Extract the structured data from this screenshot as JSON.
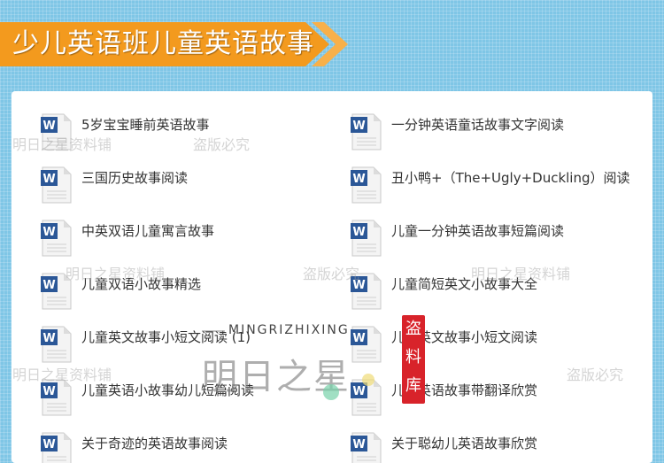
{
  "banner": {
    "title": "少儿英语班儿童英语故事"
  },
  "files_left": [
    {
      "name": "5岁宝宝睡前英语故事"
    },
    {
      "name": "三国历史故事阅读"
    },
    {
      "name": "中英双语儿童寓言故事"
    },
    {
      "name": "儿童双语小故事精选"
    },
    {
      "name": "儿童英文故事小短文阅读 (1)"
    },
    {
      "name": "儿童英语小故事幼儿短篇阅读"
    },
    {
      "name": "关于奇迹的英语故事阅读"
    }
  ],
  "files_right": [
    {
      "name": "一分钟英语童话故事文字阅读"
    },
    {
      "name": "丑小鸭+（The+Ugly+Duckling）阅读"
    },
    {
      "name": "儿童一分钟英语故事短篇阅读"
    },
    {
      "name": "儿童简短英文小故事大全"
    },
    {
      "name": "儿童英文故事小短文阅读"
    },
    {
      "name": "儿童英语故事带翻译欣赏"
    },
    {
      "name": "关于聪幼儿英语故事欣赏"
    }
  ],
  "icons": {
    "file": "word-document-icon"
  },
  "colors": {
    "banner": "#f39a1e",
    "background": "#7fc6e6",
    "doc_blue": "#2b5797"
  },
  "watermarks": [
    "明日之星资料铺",
    "盗版必究",
    "明日之星资料铺",
    "盗版必究",
    "明日之星资料铺",
    "明日之星资料铺",
    "盗版必究"
  ],
  "logo": {
    "en": "MINGRIZHIXING",
    "cn": "明日之星"
  },
  "seal": {
    "chars": [
      "盗",
      "料",
      "库"
    ]
  }
}
